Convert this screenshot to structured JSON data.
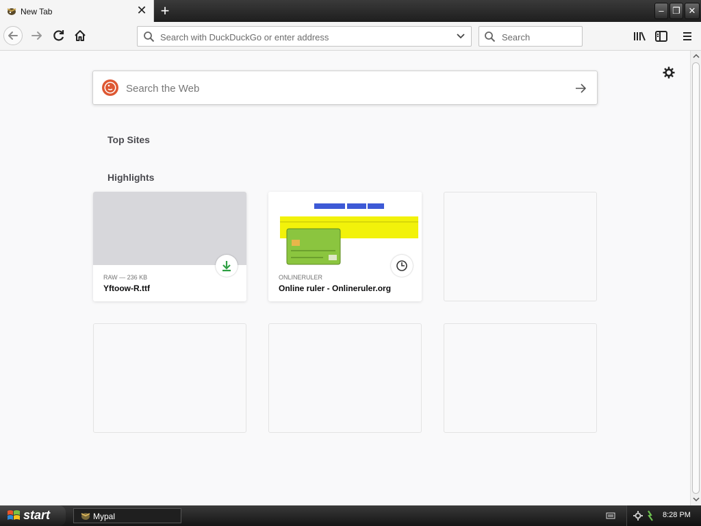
{
  "browser": {
    "tab": {
      "title": "New Tab",
      "close_glyph": "✕"
    },
    "new_tab_glyph": "+",
    "window_controls": {
      "minimize": "‒",
      "restore": "❐",
      "close": "✕"
    }
  },
  "navbar": {
    "address_placeholder": "Search with DuckDuckGo or enter address",
    "search_placeholder": "Search"
  },
  "newtab": {
    "web_search_placeholder": "Search the Web",
    "top_sites_title": "Top Sites",
    "highlights_title": "Highlights",
    "highlights": [
      {
        "meta": "RAW — 236 KB",
        "title": "Yftoow-R.ttf",
        "badge": "download-icon"
      },
      {
        "meta": "ONLINERULER",
        "title": "Online ruler - Onlineruler.org",
        "badge": "clock-icon"
      }
    ]
  },
  "taskbar": {
    "start_label": "start",
    "task_label": "Mypal",
    "clock": "8:28 PM"
  },
  "colors": {
    "duckduckgo": "#de5833",
    "download_green": "#2ea043",
    "ruler_yellow": "#f2f20a",
    "card_green": "#8bc53f"
  }
}
